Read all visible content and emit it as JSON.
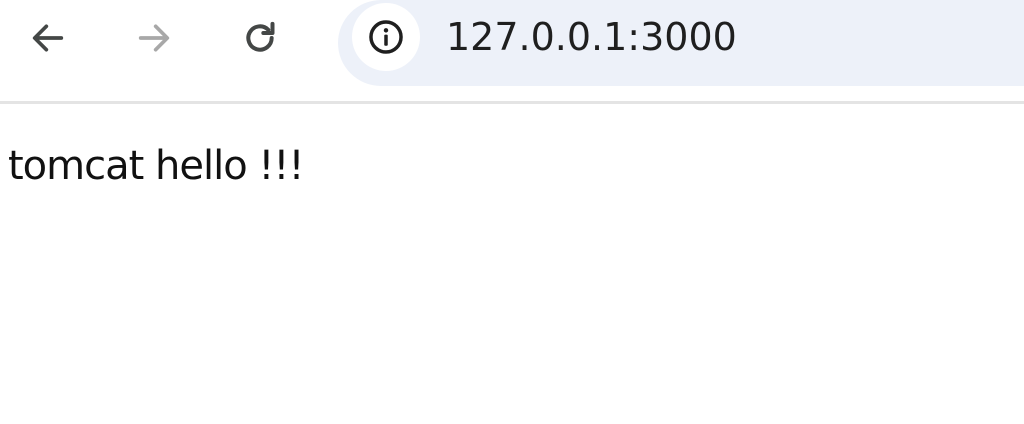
{
  "browser": {
    "url": "127.0.0.1:3000",
    "icons": {
      "back": "arrow-left-icon",
      "forward": "arrow-right-icon",
      "reload": "reload-icon",
      "site_info": "info-circle-icon"
    },
    "colors": {
      "omnibox_bg": "#edf1f9",
      "icon_active": "#444746",
      "icon_disabled": "#a8a8a8"
    }
  },
  "page": {
    "text": "tomcat hello !!!"
  }
}
